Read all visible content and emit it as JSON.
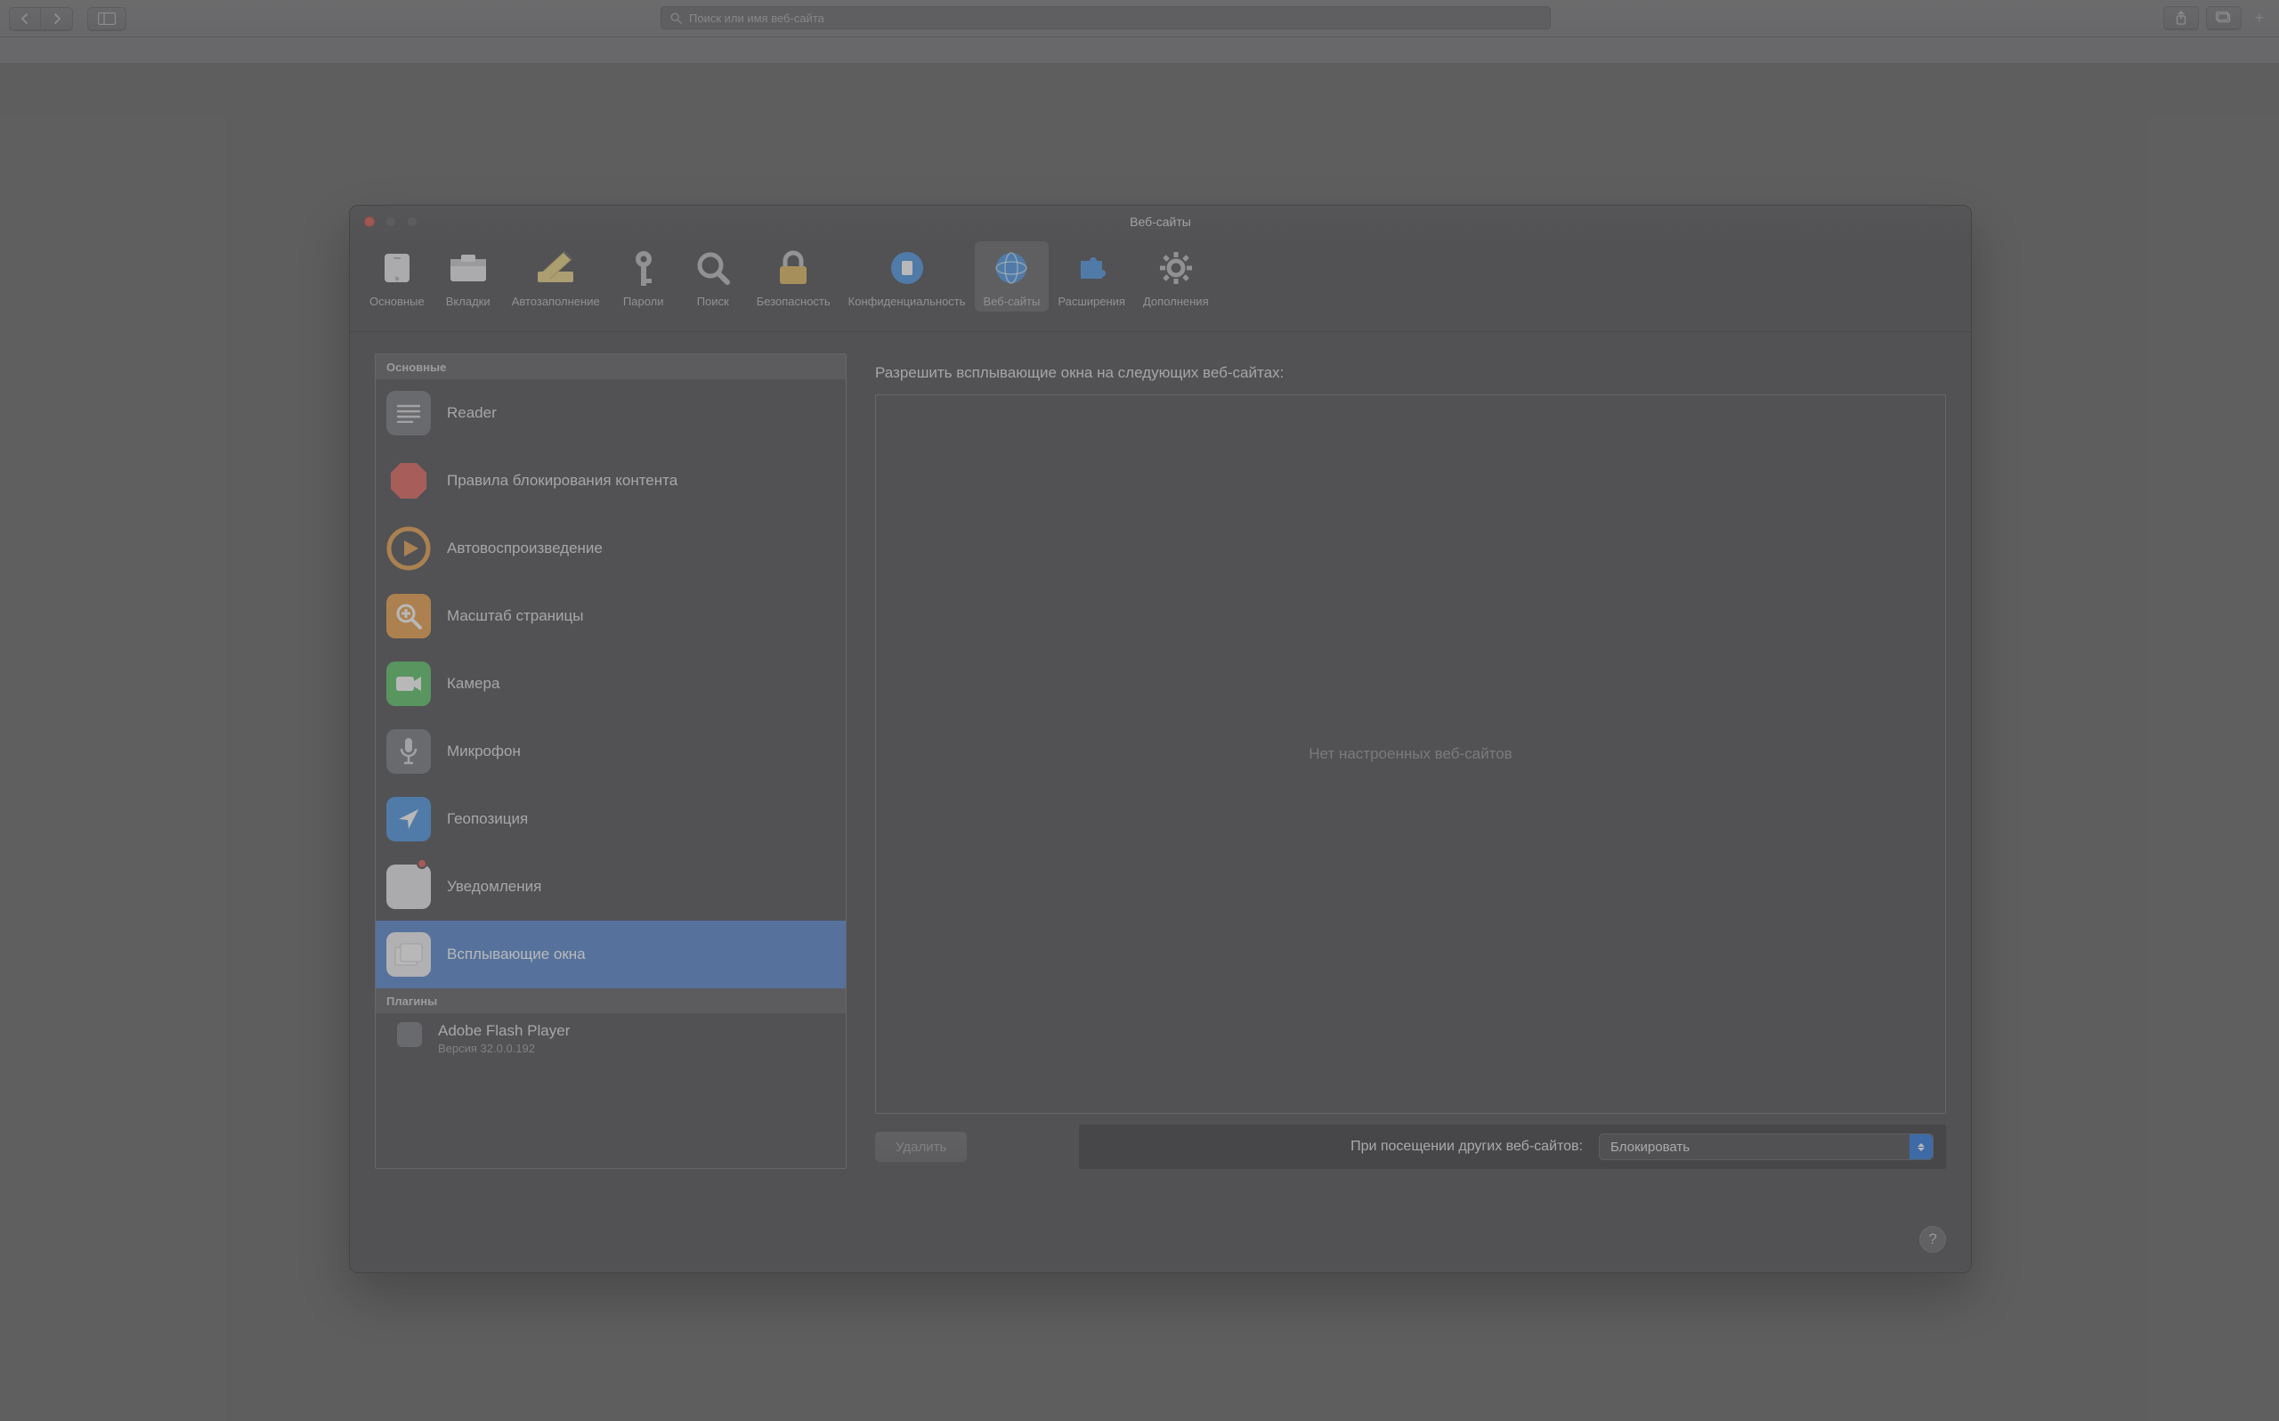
{
  "browser": {
    "address_placeholder": "Поиск или имя веб-сайта"
  },
  "prefs": {
    "window_title": "Веб-сайты",
    "toolbar": [
      {
        "id": "general",
        "label": "Основные"
      },
      {
        "id": "tabs",
        "label": "Вкладки"
      },
      {
        "id": "autofill",
        "label": "Автозаполнение"
      },
      {
        "id": "passwords",
        "label": "Пароли"
      },
      {
        "id": "search",
        "label": "Поиск"
      },
      {
        "id": "security",
        "label": "Безопасность"
      },
      {
        "id": "privacy",
        "label": "Конфиденциальность"
      },
      {
        "id": "websites",
        "label": "Веб-сайты",
        "selected": true
      },
      {
        "id": "extensions",
        "label": "Расширения"
      },
      {
        "id": "advanced",
        "label": "Дополнения"
      }
    ],
    "sidebar": {
      "main_header": "Основные",
      "items": [
        {
          "id": "reader",
          "label": "Reader"
        },
        {
          "id": "content-block",
          "label": "Правила блокирования контента"
        },
        {
          "id": "autoplay",
          "label": "Автовоспроизведение"
        },
        {
          "id": "page-zoom",
          "label": "Масштаб страницы"
        },
        {
          "id": "camera",
          "label": "Камера"
        },
        {
          "id": "microphone",
          "label": "Микрофон"
        },
        {
          "id": "location",
          "label": "Геопозиция"
        },
        {
          "id": "notifications",
          "label": "Уведомления"
        },
        {
          "id": "popups",
          "label": "Всплывающие окна",
          "selected": true
        }
      ],
      "plugins_header": "Плагины",
      "plugins": [
        {
          "id": "flash",
          "label": "Adobe Flash Player",
          "sub": "Версия 32.0.0.192"
        }
      ]
    },
    "main": {
      "heading": "Разрешить всплывающие окна на следующих веб-сайтах:",
      "empty_text": "Нет настроенных веб-сайтов",
      "delete_label": "Удалить",
      "other_sites_label": "При посещении других веб-сайтов:",
      "policy_value": "Блокировать"
    },
    "help_label": "?"
  }
}
